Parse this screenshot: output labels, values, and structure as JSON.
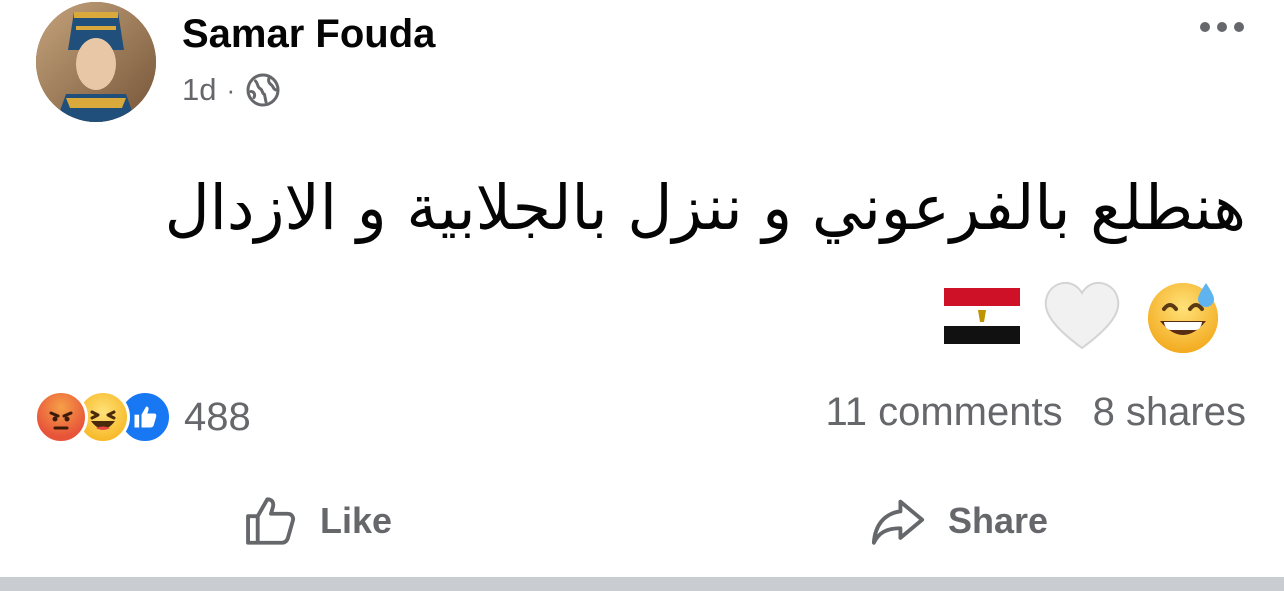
{
  "post": {
    "author": "Samar Fouda",
    "time": "1d",
    "separator": "·",
    "privacy_icon": "globe-icon",
    "text": "هنطلع بالفرعوني و ننزل بالجلابية و الازدال",
    "emojis": [
      "grinning-sweat-emoji",
      "white-heart-emoji",
      "egypt-flag-emoji"
    ]
  },
  "reactions": {
    "icons": [
      "angry-reaction-icon",
      "haha-reaction-icon",
      "like-reaction-icon"
    ],
    "count": "488"
  },
  "stats": {
    "comments": "11 comments",
    "shares": "8 shares"
  },
  "actions": {
    "like_label": "Like",
    "share_label": "Share"
  },
  "colors": {
    "accent": "#1877f2",
    "secondary_text": "#65676b",
    "primary_text": "#050505"
  }
}
